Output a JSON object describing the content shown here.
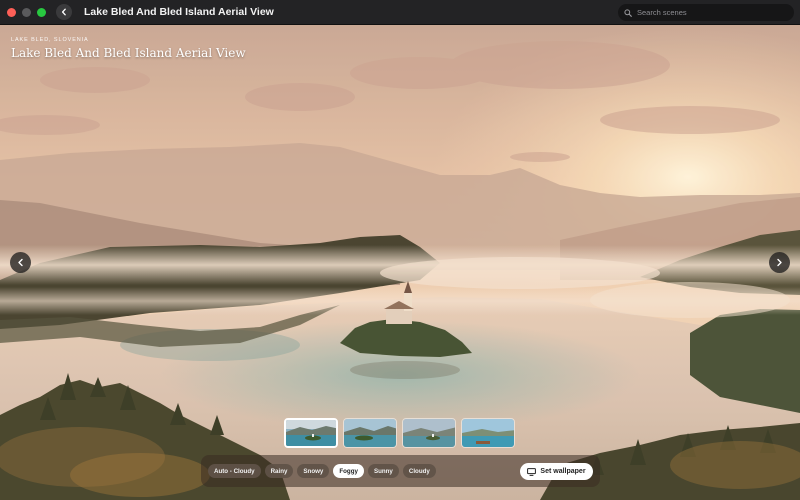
{
  "window": {
    "title": "Lake Bled And Bled Island Aerial View",
    "search_placeholder": "Search scenes"
  },
  "scene": {
    "location": "LAKE BLED, SLOVENIA",
    "title": "Lake Bled And Bled Island Aerial View"
  },
  "thumbnails": {
    "count": 4,
    "selected_index": 0
  },
  "weather": {
    "options": [
      "Auto - Cloudy",
      "Rainy",
      "Snowy",
      "Foggy",
      "Sunny",
      "Cloudy"
    ],
    "selected": "Foggy"
  },
  "actions": {
    "set_wallpaper": "Set wallpaper"
  },
  "icons": {
    "back": "chevron-left-icon",
    "search": "magnifier-icon",
    "prev": "chevron-left-icon",
    "next": "chevron-right-icon",
    "wallpaper": "monitor-icon"
  },
  "colors": {
    "close": "#fe5f57",
    "minimize": "#5a5a5c",
    "zoom": "#28c840",
    "chip_active_bg": "#ffffff",
    "chip_bg": "#5f5248"
  }
}
